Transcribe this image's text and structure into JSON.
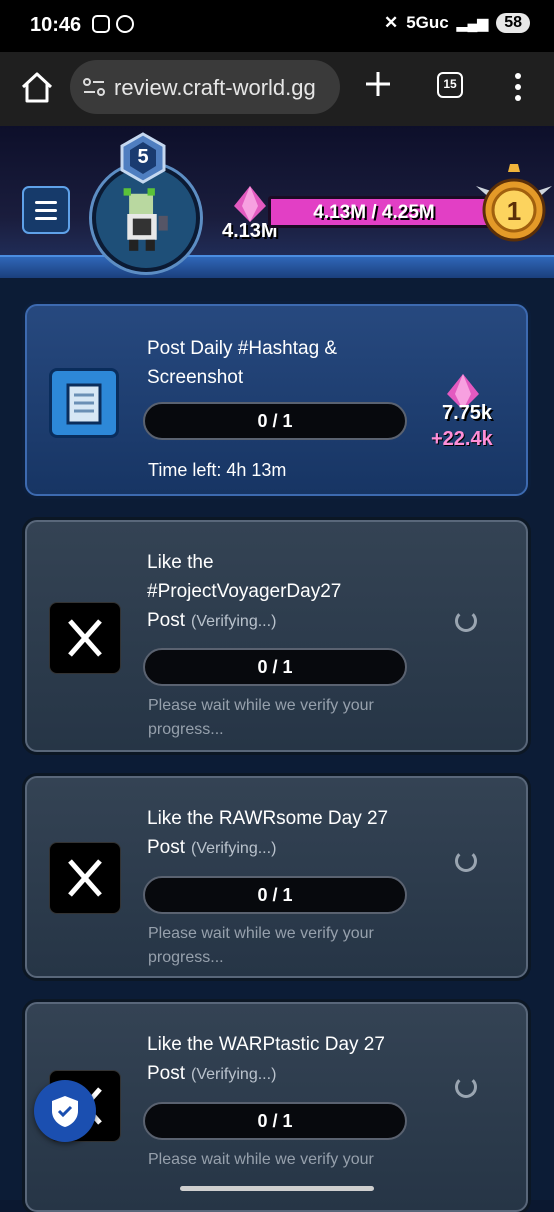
{
  "status_bar": {
    "time": "10:46",
    "network": "5Guc",
    "battery": "58"
  },
  "browser": {
    "url": "review.craft-world.gg",
    "tab_count": "15"
  },
  "header": {
    "level": "5",
    "gems": "4.13M",
    "xp_text": "4.13M / 4.25M",
    "xp_fraction": 0.972,
    "rank": "1",
    "colors": {
      "xp_bar": "#e23fc5",
      "accent": "#2f67b8"
    }
  },
  "tasks": [
    {
      "title_line1": "Post Daily #Hashtag &",
      "title_line2": "Screenshot",
      "progress": "0 / 1",
      "time_left": "Time left: 4h 13m",
      "reward": "7.75k",
      "reward_bonus": "+22.4k",
      "icon": "scroll-icon"
    },
    {
      "title_line1": "Like the",
      "title_line2": "#ProjectVoyagerDay27",
      "title_line3": "Post",
      "status": "(Verifying...)",
      "progress": "0 / 1",
      "note_line1": "Please wait while we verify your",
      "note_line2": "progress...",
      "icon": "x-logo-icon"
    },
    {
      "title_line1": "Like the RAWRsome Day 27",
      "title_line2": "Post",
      "status": "(Verifying...)",
      "progress": "0 / 1",
      "note_line1": "Please wait while we verify your",
      "note_line2": "progress...",
      "icon": "x-logo-icon"
    },
    {
      "title_line1": "Like the WARPtastic Day 27",
      "title_line2": "Post",
      "status": "(Verifying...)",
      "progress": "0 / 1",
      "note_line1": "Please wait while we verify your",
      "icon": "x-logo-icon"
    }
  ]
}
